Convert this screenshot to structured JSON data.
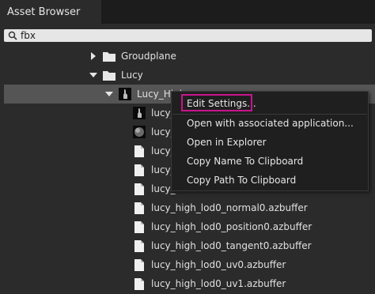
{
  "panel": {
    "title": "Asset Browser"
  },
  "search": {
    "value": "fbx"
  },
  "tree": {
    "rows": [
      {
        "label": "Groudplane",
        "icon": "folder-icon",
        "arrow": "chevron-right-icon"
      },
      {
        "label": "Lucy",
        "icon": "folder-icon",
        "arrow": "chevron-down-icon"
      },
      {
        "label": "Lucy_High",
        "icon": "mesh-thumbnail-icon",
        "arrow": "chevron-down-icon",
        "selected": true
      },
      {
        "label": "lucy_",
        "icon": "mesh-thumbnail-icon"
      },
      {
        "label": "lucy_",
        "icon": "sphere-thumbnail-icon"
      },
      {
        "label": "lucy_",
        "icon": "file-icon"
      },
      {
        "label": "lucy_",
        "icon": "file-icon"
      },
      {
        "label": "lucy_",
        "icon": "file-icon"
      },
      {
        "label": "lucy_high_lod0_normal0.azbuffer",
        "icon": "file-icon"
      },
      {
        "label": "lucy_high_lod0_position0.azbuffer",
        "icon": "file-icon"
      },
      {
        "label": "lucy_high_lod0_tangent0.azbuffer",
        "icon": "file-icon"
      },
      {
        "label": "lucy_high_lod0_uv0.azbuffer",
        "icon": "file-icon"
      },
      {
        "label": "lucy_high_lod0_uv1.azbuffer",
        "icon": "file-icon"
      }
    ]
  },
  "context_menu": {
    "items": [
      {
        "label": "Edit Settings..."
      },
      {
        "label": "Open with associated application..."
      },
      {
        "label": "Open in Explorer"
      },
      {
        "label": "Copy Name To Clipboard"
      },
      {
        "label": "Copy Path To Clipboard"
      }
    ]
  },
  "colors": {
    "background": "#2b2b2b",
    "selection": "#555555",
    "highlight_outline": "#c8148c"
  }
}
